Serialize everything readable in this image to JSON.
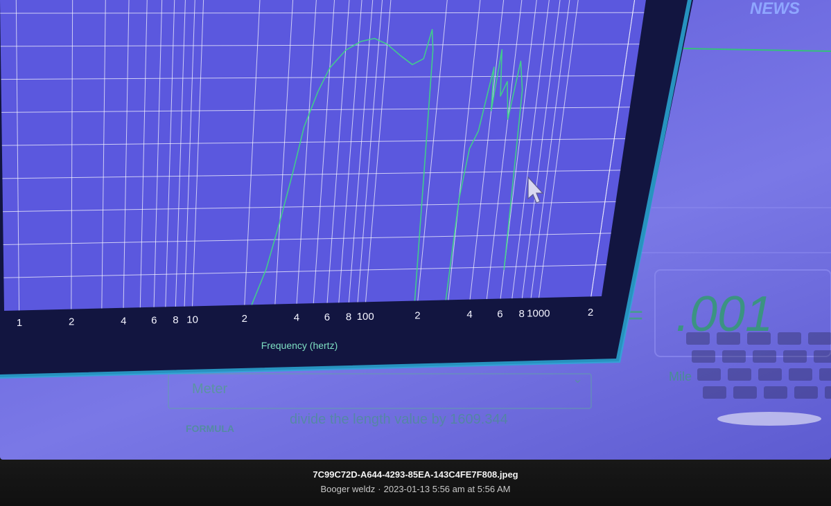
{
  "photo": {
    "screen": {
      "news_label": "NEWS",
      "readout_value": ".001",
      "equals_sign": "=",
      "unit_from": "Meter",
      "unit_to": "Mile",
      "formula_label": "FORMULA",
      "formula_text": "divide the length value by 1609.344"
    },
    "chart_data": {
      "type": "line",
      "title": "",
      "xlabel": "Frequency (hertz)",
      "ylabel": "",
      "xscale": "log",
      "xlim": [
        1,
        2000
      ],
      "x_tick_labels": [
        {
          "label": "1",
          "value": 1
        },
        {
          "label": "2",
          "value": 2
        },
        {
          "label": "4",
          "value": 4
        },
        {
          "label": "6",
          "value": 6
        },
        {
          "label": "8",
          "value": 8
        },
        {
          "label": "10",
          "value": 10
        },
        {
          "label": "2",
          "value": 20
        },
        {
          "label": "4",
          "value": 40
        },
        {
          "label": "6",
          "value": 60
        },
        {
          "label": "8",
          "value": 80
        },
        {
          "label": "100",
          "value": 100
        },
        {
          "label": "2",
          "value": 200
        },
        {
          "label": "4",
          "value": 400
        },
        {
          "label": "6",
          "value": 600
        },
        {
          "label": "8",
          "value": 800
        },
        {
          "label": "1000",
          "value": 1000
        },
        {
          "label": "2",
          "value": 2000
        }
      ],
      "line_color": "#3fd884",
      "grid": true,
      "series": [
        {
          "values": [
            [
              22,
              0.0
            ],
            [
              26,
              0.12
            ],
            [
              30,
              0.28
            ],
            [
              34,
              0.44
            ],
            [
              38,
              0.6
            ],
            [
              44,
              0.72
            ],
            [
              50,
              0.8
            ],
            [
              60,
              0.86
            ],
            [
              72,
              0.89
            ],
            [
              85,
              0.9
            ],
            [
              100,
              0.88
            ],
            [
              120,
              0.84
            ],
            [
              140,
              0.81
            ],
            [
              160,
              0.83
            ],
            [
              172,
              0.93
            ],
            [
              178,
              0.86
            ],
            [
              185,
              0.4
            ],
            [
              192,
              0.0
            ]
          ]
        },
        {
          "values": [
            [
              290,
              0.0
            ],
            [
              300,
              0.35
            ],
            [
              320,
              0.52
            ],
            [
              350,
              0.58
            ],
            [
              375,
              0.72
            ],
            [
              390,
              0.8
            ],
            [
              400,
              0.65
            ],
            [
              420,
              0.86
            ],
            [
              440,
              0.7
            ],
            [
              470,
              0.75
            ],
            [
              500,
              0.62
            ],
            [
              540,
              0.82
            ],
            [
              575,
              0.72
            ],
            [
              600,
              0.1
            ]
          ]
        }
      ]
    }
  },
  "caption": {
    "filename": "7C99C72D-A644-4293-85EA-143C4FE7F808.jpeg",
    "author": "Booger weldz",
    "separator": "·",
    "timestamp": "2023-01-13 5:56 am at 5:56 AM"
  }
}
